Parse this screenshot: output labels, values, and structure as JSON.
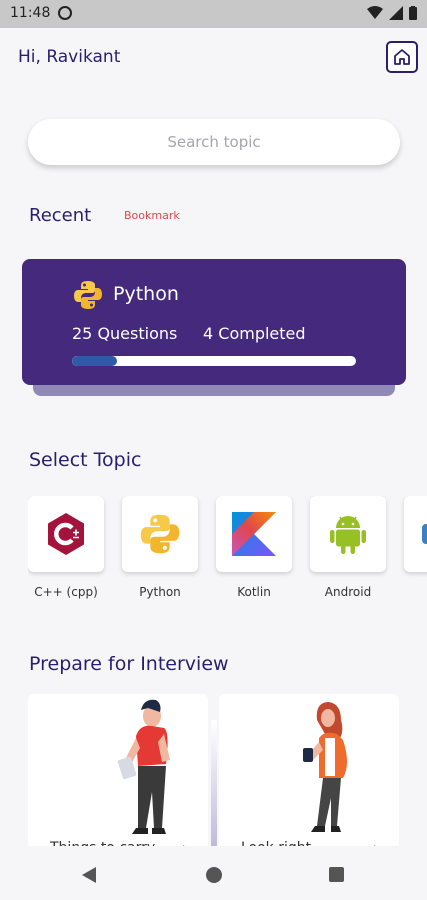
{
  "status_bar": {
    "time": "11:48"
  },
  "header": {
    "greeting": "Hi, Ravikant"
  },
  "search": {
    "placeholder": "Search topic"
  },
  "tabs": {
    "recent": "Recent",
    "bookmark": "Bookmark"
  },
  "recent_card": {
    "title": "Python",
    "questions": "25 Questions",
    "completed": "4 Completed",
    "progress_fraction": 0.16,
    "background_color": "#45297d",
    "progress_color": "#2e5aa8"
  },
  "select_topic": {
    "title": "Select Topic",
    "topics": [
      {
        "label": "C++ (cpp)",
        "icon": "cpp-icon"
      },
      {
        "label": "Python",
        "icon": "python-icon"
      },
      {
        "label": "Kotlin",
        "icon": "kotlin-icon"
      },
      {
        "label": "Android",
        "icon": "android-icon"
      },
      {
        "label": "",
        "icon": "partial-topic-icon"
      }
    ]
  },
  "interview": {
    "title": "Prepare for Interview",
    "cards": [
      {
        "label": "Things to carry",
        "arrow": "›"
      },
      {
        "label": "Look right",
        "arrow": "›"
      }
    ]
  },
  "colors": {
    "primary": "#2a1f6e",
    "accent_red": "#e0484d",
    "background": "#f6f6f8"
  }
}
